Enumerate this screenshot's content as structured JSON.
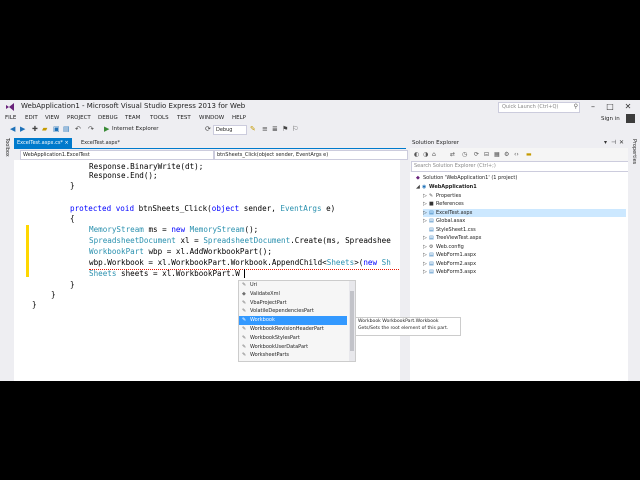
{
  "window": {
    "title": "WebApplication1 - Microsoft Visual Studio Express 2013 for Web"
  },
  "quick_launch": {
    "placeholder": "Quick Launch (Ctrl+Q)"
  },
  "menu": [
    "FILE",
    "EDIT",
    "VIEW",
    "PROJECT",
    "DEBUG",
    "TEAM",
    "TOOLS",
    "TEST",
    "WINDOW",
    "HELP"
  ],
  "account": {
    "signin": "Sign in"
  },
  "toolbar": {
    "run_target": "Internet Explorer",
    "config": "Debug"
  },
  "side_tabs": {
    "left": "Toolbox",
    "right": "Properties"
  },
  "editor": {
    "tabs": [
      {
        "label": "ExcelTest.aspx.cs*",
        "close": "×"
      },
      {
        "label": "ExcelTest.aspx*"
      }
    ],
    "nav_class": "WebApplication1.ExcelTest",
    "nav_member": "btnSheets_Click(object sender, EventArgs e)"
  },
  "code": {
    "line1": "Response.BinaryWrite(dt);",
    "line2": "Response.End();",
    "brace_close_1": "}",
    "sig_protected": "protected",
    "sig_void": "void",
    "sig_name": "btnSheets_Click(",
    "sig_object": "object",
    "sig_sender": "sender,",
    "sig_eventargs": "EventArgs",
    "sig_e": "e)",
    "brace_open": "{",
    "l1_type": "MemoryStream",
    "l1_mid": "ms =",
    "l1_new": "new",
    "l1_type2": "MemoryStream",
    "l1_end": "();",
    "l2_type": "SpreadsheetDocument",
    "l2_mid": "xl =",
    "l2_type2": "SpreadsheetDocument",
    "l2_end": ".Create(ms, Spreadshee",
    "l3_type": "WorkbookPart",
    "l3_end": "wbp = xl.AddWorkbookPart();",
    "l4_start": "wbp.Workbook = xl.WorkbookPart.Workbook.AppendChild<",
    "l4_type": "Sheets",
    "l4_mid": ">(",
    "l4_new": "new",
    "l4_end": "Sh",
    "l5_type": "Sheets",
    "l5_end": "sheets = xl.WorkbookPart.W",
    "brace_close_2": "}",
    "brace_close_3": "}",
    "brace_close_4": "}"
  },
  "intellisense": {
    "items": [
      "Uri",
      "ValidateXml",
      "VbaProjectPart",
      "VolatileDependenciesPart",
      "Workbook",
      "WorkbookRevisionHeaderPart",
      "WorkbookStylesPart",
      "WorkbookUserDataPart",
      "WorksheetParts"
    ],
    "selected_index": 4,
    "tooltip_line1": "Workbook WorkbookPart.Workbook",
    "tooltip_line2": "Gets/Sets the root element of this part."
  },
  "solution_explorer": {
    "title": "Solution Explorer",
    "search_placeholder": "Search Solution Explorer (Ctrl+;)",
    "items": [
      {
        "label": "Solution 'WebApplication1' (1 project)",
        "icon": "solution-icon",
        "expand": ""
      },
      {
        "label": "WebApplication1",
        "icon": "web-project-icon",
        "expand": "◢"
      },
      {
        "label": "Properties",
        "icon": "wrench-icon",
        "expand": "▷"
      },
      {
        "label": "References",
        "icon": "references-icon",
        "expand": "▷"
      },
      {
        "label": "ExcelTest.aspx",
        "icon": "aspx-file-icon",
        "expand": "▷"
      },
      {
        "label": "Global.asax",
        "icon": "asax-file-icon",
        "expand": "▷"
      },
      {
        "label": "StyleSheet1.css",
        "icon": "css-file-icon",
        "expand": ""
      },
      {
        "label": "TreeViewTest.aspx",
        "icon": "aspx-file-icon",
        "expand": "▷"
      },
      {
        "label": "Web.config",
        "icon": "config-file-icon",
        "expand": "▷"
      },
      {
        "label": "WebForm1.aspx",
        "icon": "aspx-file-icon",
        "expand": "▷"
      },
      {
        "label": "WebForm2.aspx",
        "icon": "aspx-file-icon",
        "expand": "▷"
      },
      {
        "label": "WebForm3.aspx",
        "icon": "aspx-file-icon",
        "expand": "▷"
      }
    ],
    "selected_index": 4
  },
  "colors": {
    "accent": "#007acc",
    "keyword": "#0000ff",
    "type": "#2b91af",
    "selection": "#3399ff"
  }
}
